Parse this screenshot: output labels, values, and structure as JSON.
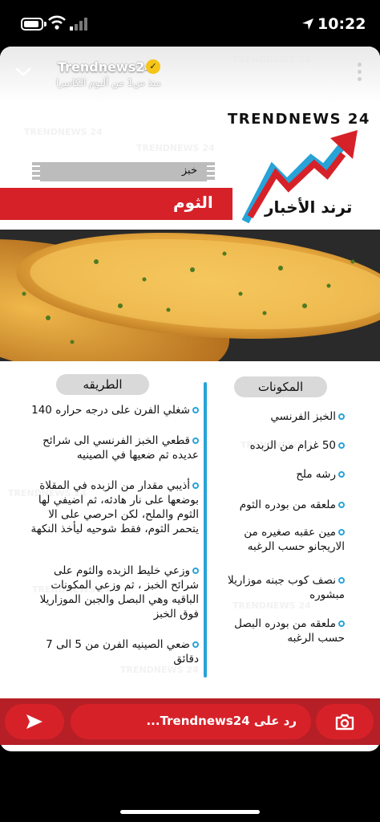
{
  "status_bar": {
    "time": "10:22"
  },
  "story": {
    "account_name": "Trendnews24",
    "subtitle": "منذ س1 من ألبوم الكاميرا",
    "verified_icon": "verified-badge-icon"
  },
  "logo": {
    "text": "TRENDNEWS 24",
    "arabic": "ترند الأخبار",
    "colors": {
      "arrow_red": "#d72129",
      "arrow_blue": "#27a3d8"
    }
  },
  "recipe": {
    "category": "خبز",
    "title": "الثوم"
  },
  "ingredients": {
    "header": "المكونات",
    "items": [
      "الخبز الفرنسي",
      "50 غرام من الزبده",
      "رشه ملح",
      "ملعقه من بودره الثوم",
      "مين عقبه صغيره من الاريجانو حسب الرغبه",
      "نصف كوب جبنه موزاريلا مبشوره",
      "ملعقه من بودره البصل حسب الرغبه"
    ]
  },
  "method": {
    "header": "الطريقه",
    "items": [
      "شغلي الفرن على درجه حراره 140",
      "قطعي الخبز الفرنسي الى شرائح عديده ثم ضعيها في الصينيه",
      "أذيبي مقدار من الزبده في المقلاة بوضعها على نار هادئه، ثم اضيفي لها الثوم والملح، لكن احرصي على الا يتحمر الثوم، فقط شوحيه ليأخذ النكهة",
      "وزعي خليط الزبده والثوم على شرائح الخبز ، ثم وزعي المكونات الباقيه وهي البصل والجبن الموزاريلا فوق الخبز",
      "ضعي الصينيه الفرن من 5 الى 7 دقائق"
    ]
  },
  "reply_bar": {
    "placeholder": "رد على Trendnews24..."
  },
  "colors": {
    "accent_blue": "#27a3d8",
    "brand_red": "#d72129",
    "reply_bar_red": "#b61f26"
  }
}
